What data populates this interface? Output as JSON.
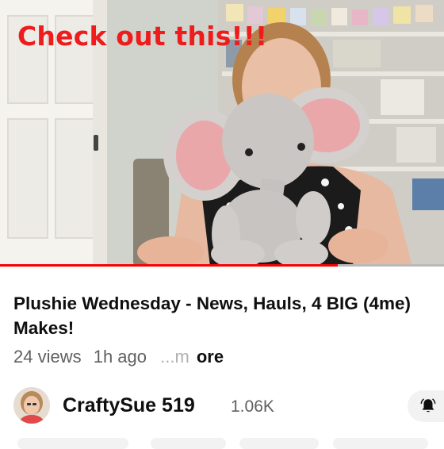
{
  "video": {
    "overlay_text": "Check out this!!!",
    "progress": 0.76
  },
  "details": {
    "title": "Plushie Wednesday - News, Hauls, 4 BIG (4me) Makes!",
    "views": "24 views",
    "age": "1h ago",
    "more_prefix": "...m",
    "more_suffix": "ore"
  },
  "channel": {
    "name": "CraftySue 519",
    "subscribers": "1.06K",
    "bell_icon": "bell-icon"
  },
  "colors": {
    "overlay_red": "#ee1c1c",
    "progress_red": "#ff0000"
  }
}
